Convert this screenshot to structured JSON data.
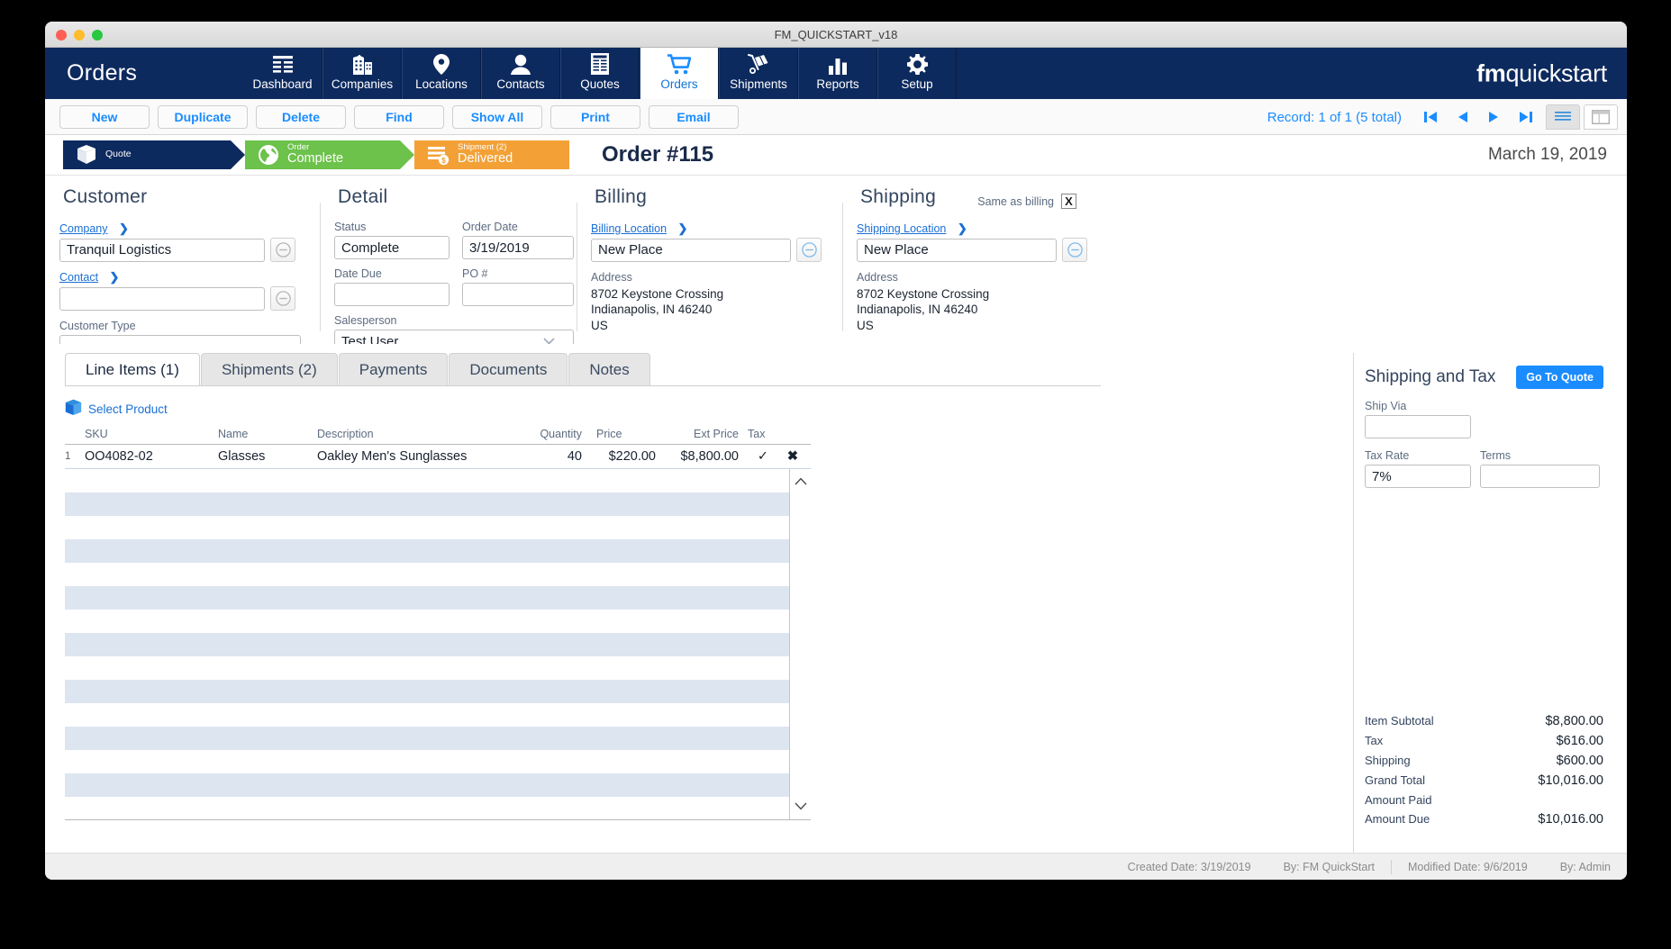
{
  "window": {
    "title": "FM_QUICKSTART_v18"
  },
  "nav": {
    "app_title": "Orders",
    "brand_bold": "fm",
    "brand_rest": "quickstart",
    "items": [
      {
        "label": "Dashboard",
        "icon": "grid-icon",
        "active": false
      },
      {
        "label": "Companies",
        "icon": "building-icon",
        "active": false
      },
      {
        "label": "Locations",
        "icon": "map-pin-icon",
        "active": false
      },
      {
        "label": "Contacts",
        "icon": "person-icon",
        "active": false
      },
      {
        "label": "Quotes",
        "icon": "document-icon",
        "active": false
      },
      {
        "label": "Orders",
        "icon": "shopping-cart-icon",
        "active": true
      },
      {
        "label": "Shipments",
        "icon": "hand-truck-icon",
        "active": false
      },
      {
        "label": "Reports",
        "icon": "bar-chart-icon",
        "active": false
      },
      {
        "label": "Setup",
        "icon": "gear-icon",
        "active": false
      }
    ]
  },
  "toolbar": {
    "buttons": [
      "New",
      "Duplicate",
      "Delete",
      "Find",
      "Show All",
      "Print",
      "Email"
    ],
    "record_label": "Record:  1 of 1 (5 total)",
    "nav_first": "⏮",
    "nav_prev": "◀",
    "nav_next": "▶",
    "nav_last": "⏭"
  },
  "ribbon": {
    "steps": [
      {
        "top": "",
        "bottom": "Quote",
        "single": true,
        "icon": "box-icon",
        "color": "#0d2a5e"
      },
      {
        "top": "Order",
        "bottom": "Complete",
        "single": false,
        "icon": "globe-icon",
        "color": "#6cc24a"
      },
      {
        "top": "Shipment (2)",
        "bottom": "Delivered",
        "single": false,
        "icon": "invoice-icon",
        "color": "#f3a137"
      }
    ],
    "order_number": "Order #115",
    "date": "March 19, 2019"
  },
  "customer": {
    "heading": "Customer",
    "company_link": "Company",
    "company_value": "Tranquil Logistics",
    "contact_link": "Contact",
    "contact_value": "",
    "customer_type_label": "Customer Type",
    "customer_type_value": ""
  },
  "detail": {
    "heading": "Detail",
    "status_label": "Status",
    "status_value": "Complete",
    "order_date_label": "Order Date",
    "order_date_value": "3/19/2019",
    "date_due_label": "Date Due",
    "date_due_value": "",
    "po_label": "PO #",
    "po_value": "",
    "salesperson_label": "Salesperson",
    "salesperson_value": "Test User"
  },
  "billing": {
    "heading": "Billing",
    "location_link": "Billing Location",
    "location_value": "New Place",
    "address_label": "Address",
    "address_lines": [
      "8702 Keystone Crossing",
      "Indianapolis, IN 46240",
      "US"
    ]
  },
  "shipping": {
    "heading": "Shipping",
    "same_as_billing_label": "Same as billing",
    "same_as_billing_value": "X",
    "location_link": "Shipping Location",
    "location_value": "New Place",
    "address_label": "Address",
    "address_lines": [
      "8702 Keystone Crossing",
      "Indianapolis, IN 46240",
      "US"
    ]
  },
  "tabs": [
    {
      "label": "Line Items (1)",
      "active": true
    },
    {
      "label": "Shipments (2)",
      "active": false
    },
    {
      "label": "Payments",
      "active": false
    },
    {
      "label": "Documents",
      "active": false
    },
    {
      "label": "Notes",
      "active": false
    }
  ],
  "line_items": {
    "select_product_label": "Select Product",
    "columns": [
      "SKU",
      "Name",
      "Description",
      "Quantity",
      "Price",
      "Ext Price",
      "Tax"
    ],
    "rows": [
      {
        "num": "1",
        "sku": "OO4082-02",
        "name": "Glasses",
        "description": "Oakley Men's Sunglasses",
        "quantity": "40",
        "price": "$220.00",
        "ext_price": "$8,800.00",
        "tax": "✓",
        "delete": "✖"
      }
    ]
  },
  "shipping_tax": {
    "heading": "Shipping and Tax",
    "go_to_quote": "Go To Quote",
    "ship_via_label": "Ship Via",
    "ship_via_value": "",
    "tax_rate_label": "Tax Rate",
    "tax_rate_value": "7%",
    "terms_label": "Terms",
    "terms_value": "",
    "totals": [
      {
        "key": "Item Subtotal",
        "value": "$8,800.00"
      },
      {
        "key": "Tax",
        "value": "$616.00"
      },
      {
        "key": "Shipping",
        "value": "$600.00"
      },
      {
        "key": "Grand Total",
        "value": "$10,016.00"
      },
      {
        "key": "Amount Paid",
        "value": ""
      },
      {
        "key": "Amount Due",
        "value": "$10,016.00"
      }
    ]
  },
  "footer": {
    "created": "Created Date: 3/19/2019",
    "created_by": "By: FM QuickStart",
    "modified": "Modified Date: 9/6/2019",
    "modified_by": "By: Admin"
  },
  "colors": {
    "navy": "#0d2a5e",
    "accent_blue": "#1a8cff",
    "link_blue": "#1a6fd4",
    "green": "#6cc24a",
    "orange": "#f3a137"
  }
}
